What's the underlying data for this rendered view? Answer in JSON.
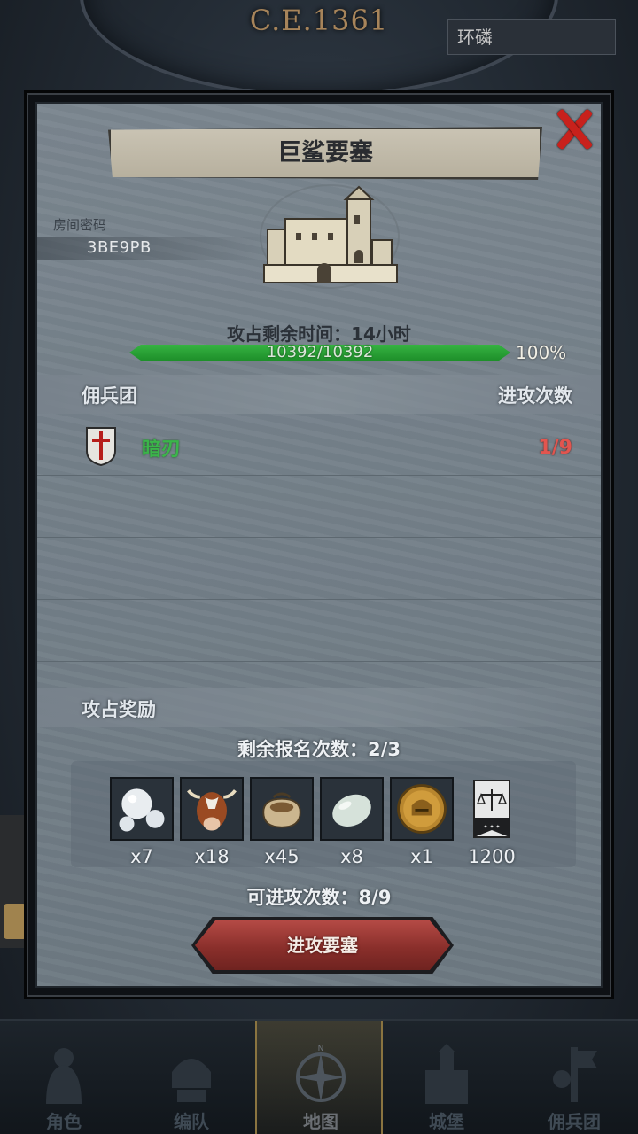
{
  "background": {
    "era": "C.E.1361",
    "chip_text": "环磷"
  },
  "modal": {
    "title": "巨鲨要塞",
    "room_label": "房间密码",
    "room_code": "3BE9PB",
    "time_remaining": "攻占剩余时间：14小时",
    "progress": {
      "text": "10392/10392",
      "percent_label": "100%",
      "fraction": 1.0
    },
    "mercenary_header": "佣兵团",
    "attacks_header": "进攻次数",
    "mercenaries": [
      {
        "name": "暗刃",
        "count": "1/9"
      }
    ],
    "reward_header": "攻占奖励",
    "signups_left": "剩余报名次数：2/3",
    "rewards": [
      {
        "icon": "pearls-icon",
        "qty": "x7"
      },
      {
        "icon": "ox-icon",
        "qty": "x18"
      },
      {
        "icon": "grain-sack-icon",
        "qty": "x45"
      },
      {
        "icon": "gem-stone-icon",
        "qty": "x8"
      },
      {
        "icon": "helmet-coin-icon",
        "qty": "x1"
      },
      {
        "icon": "justice-banner-icon",
        "qty": "1200"
      }
    ],
    "attacks_left": "可进攻次数：8/9",
    "attack_button": "进攻要塞"
  },
  "nav": [
    {
      "label": "角色",
      "icon": "knight-icon"
    },
    {
      "label": "编队",
      "icon": "helmet-icon"
    },
    {
      "label": "地图",
      "icon": "compass-icon",
      "active": true
    },
    {
      "label": "城堡",
      "icon": "castle-icon"
    },
    {
      "label": "佣兵团",
      "icon": "mercenary-icon"
    }
  ],
  "colors": {
    "accent_green": "#3bb54a",
    "accent_red": "#e2554f",
    "close_red": "#c8211c",
    "button_red": "#8a2f2b",
    "panel": "#76828b"
  }
}
